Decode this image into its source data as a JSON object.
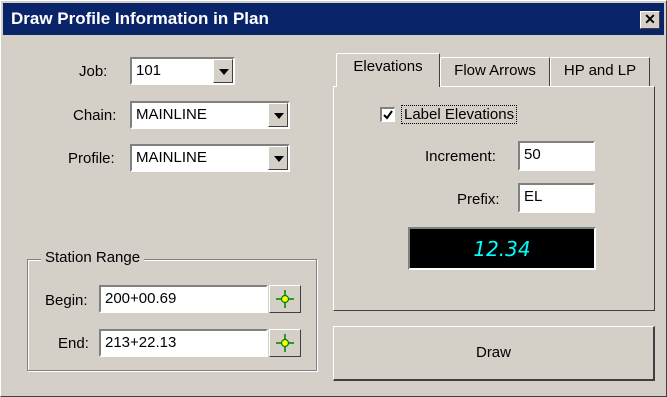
{
  "window": {
    "title": "Draw Profile Information in Plan",
    "close_icon": "close-icon"
  },
  "form": {
    "job": {
      "label": "Job:",
      "value": "101"
    },
    "chain": {
      "label": "Chain:",
      "value": "MAINLINE"
    },
    "profile": {
      "label": "Profile:",
      "value": "MAINLINE"
    }
  },
  "station_range": {
    "title": "Station Range",
    "begin": {
      "label": "Begin:",
      "value": "200+00.69"
    },
    "end": {
      "label": "End:",
      "value": "213+22.13"
    }
  },
  "tabs": [
    {
      "label": "Elevations",
      "active": true
    },
    {
      "label": "Flow Arrows",
      "active": false
    },
    {
      "label": "HP and LP",
      "active": false
    }
  ],
  "elevations": {
    "label_elevations": {
      "label": "Label Elevations",
      "checked": true
    },
    "increment": {
      "label": "Increment:",
      "value": "50"
    },
    "prefix": {
      "label": "Prefix:",
      "value": "EL"
    },
    "preview": "12.34"
  },
  "buttons": {
    "draw": "Draw"
  },
  "colors": {
    "titlebar": "#0a246a",
    "lcd_text": "#00ffff",
    "face": "#d4d0c8"
  }
}
